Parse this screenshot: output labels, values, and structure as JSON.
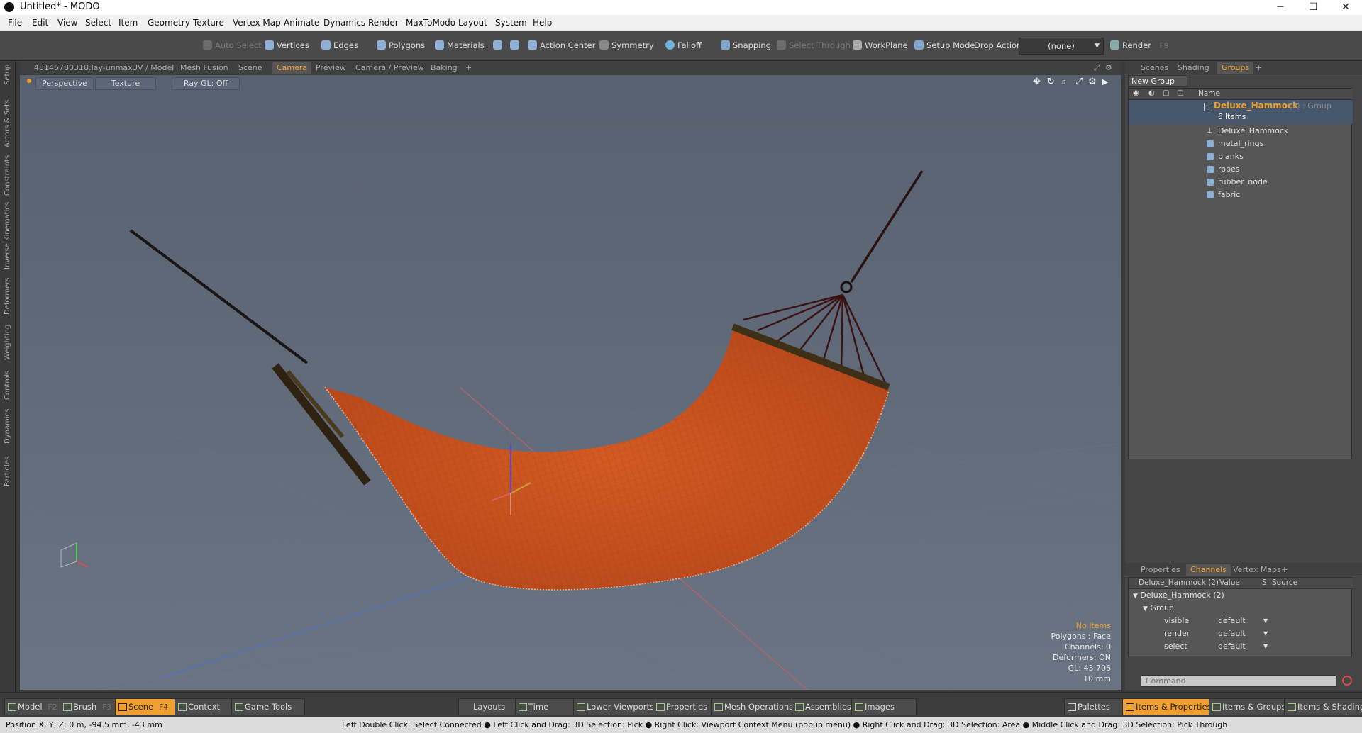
{
  "window": {
    "title": "Untitled* - MODO",
    "minimize": "─",
    "maximize": "☐",
    "close": "✕"
  },
  "menu": [
    "File",
    "Edit",
    "View",
    "Select",
    "Item",
    "Geometry",
    "Texture",
    "Vertex Map",
    "Animate",
    "Dynamics",
    "Render",
    "MaxToModo",
    "Layout",
    "System",
    "Help"
  ],
  "toolbar": {
    "auto_select": "Auto Select",
    "vertices": "Vertices",
    "edges": "Edges",
    "polygons": "Polygons",
    "materials": "Materials",
    "action_center": "Action Center",
    "symmetry": "Symmetry",
    "falloff": "Falloff",
    "snapping": "Snapping",
    "select_through": "Select Through",
    "workplane": "WorkPlane",
    "setup_mode": "Setup Mode",
    "drop_action": "Drop Action",
    "drop_value": "(none)",
    "render": "Render",
    "render_key": "F9"
  },
  "viewport_tabs": [
    "48146780318:lay-unmax",
    "UV / Model",
    "Mesh Fusion",
    "Scene",
    "Camera",
    "Preview",
    "Camera / Preview",
    "Baking",
    "+"
  ],
  "viewport_active_tab": "Camera",
  "viewport_buttons": {
    "perspective": "Perspective",
    "texture": "Texture",
    "raygl": "Ray GL: Off"
  },
  "viewport_info": {
    "items": "No Items",
    "polygons": "Polygons : Face",
    "channels": "Channels: 0",
    "deformers": "Deformers: ON",
    "gl": "GL: 43,706",
    "scale": "10 mm"
  },
  "left_tabs": [
    "Setup",
    "Actors & Sets",
    "Constraints",
    "Inverse Kinematics",
    "Deformers",
    "Weighting",
    "Controls",
    "Dynamics",
    "Particles"
  ],
  "right_top_tabs": [
    "Scenes",
    "Shading",
    "Groups",
    "+"
  ],
  "right_top_active": "Groups",
  "groups": {
    "new_group": "New Group",
    "name_header": "Name",
    "root": {
      "name": "Deluxe_Hammock",
      "suffix": "(2) : Group",
      "count": "6 Items"
    },
    "children": [
      "Deluxe_Hammock",
      "metal_rings",
      "planks",
      "ropes",
      "rubber_node",
      "fabric"
    ]
  },
  "right_bottom_tabs": [
    "Properties",
    "Channels",
    "Vertex Maps",
    "+"
  ],
  "right_bottom_active": "Channels",
  "channels": {
    "headers": {
      "name": "Deluxe_Hammock (2)",
      "value": "Value",
      "s": "S",
      "source": "Source"
    },
    "tree_root": "Deluxe_Hammock (2)",
    "tree_group": "Group",
    "rows": [
      {
        "name": "visible",
        "value": "default"
      },
      {
        "name": "render",
        "value": "default"
      },
      {
        "name": "select",
        "value": "default"
      }
    ],
    "command_placeholder": "Command"
  },
  "bottom_left": [
    {
      "label": "Model",
      "key": "F2"
    },
    {
      "label": "Brush",
      "key": "F3"
    },
    {
      "label": "Scene",
      "key": "F4"
    },
    {
      "label": "Context",
      "key": ""
    },
    {
      "label": "Game Tools",
      "key": ""
    }
  ],
  "bottom_center": [
    "Layouts",
    "Time",
    "Lower Viewports",
    "Properties",
    "Mesh Operations",
    "Assemblies",
    "Images"
  ],
  "bottom_right": [
    "Palettes",
    "Items & Properties",
    "Items & Groups",
    "Items & Shading"
  ],
  "status": {
    "position": "Position X, Y, Z:   0 m, -94.5 mm, -43 mm",
    "hints": "Left Double Click: Select Connected ● Left Click and Drag: 3D Selection: Pick ● Right Click: Viewport Context Menu (popup menu) ● Right Click and Drag: 3D Selection: Area ● Middle Click and Drag: 3D Selection: Pick Through"
  },
  "colors": {
    "accent": "#f0a030",
    "fabric": "#c9521f",
    "viewport_top": "#58616f",
    "viewport_bottom": "#6a7483"
  }
}
